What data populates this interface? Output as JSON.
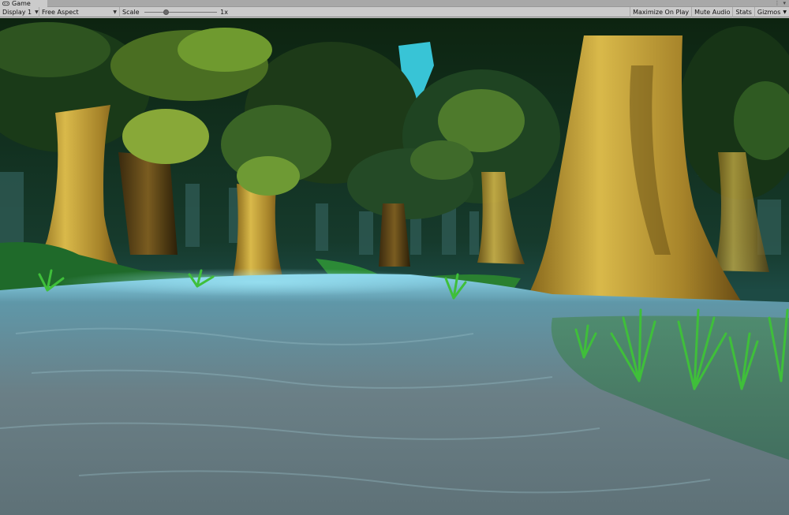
{
  "window": {
    "tab_title": "Game",
    "tab_icon": "gamepad-icon"
  },
  "toolbar": {
    "display": "Display 1",
    "aspect": "Free Aspect",
    "scale_label": "Scale",
    "scale_value": "1x",
    "maximize_on_play": "Maximize On Play",
    "mute_audio": "Mute Audio",
    "stats": "Stats",
    "gizmos": "Gizmos"
  },
  "viewport": {
    "scene": "stylized forest river",
    "colors": {
      "sky": "#3fc6d8",
      "foliage_dark": "#1c3a18",
      "foliage_light": "#7fa63a",
      "trunk": "#b8952e",
      "water": "#6a8ea0",
      "grass": "#2c8a2a"
    }
  }
}
